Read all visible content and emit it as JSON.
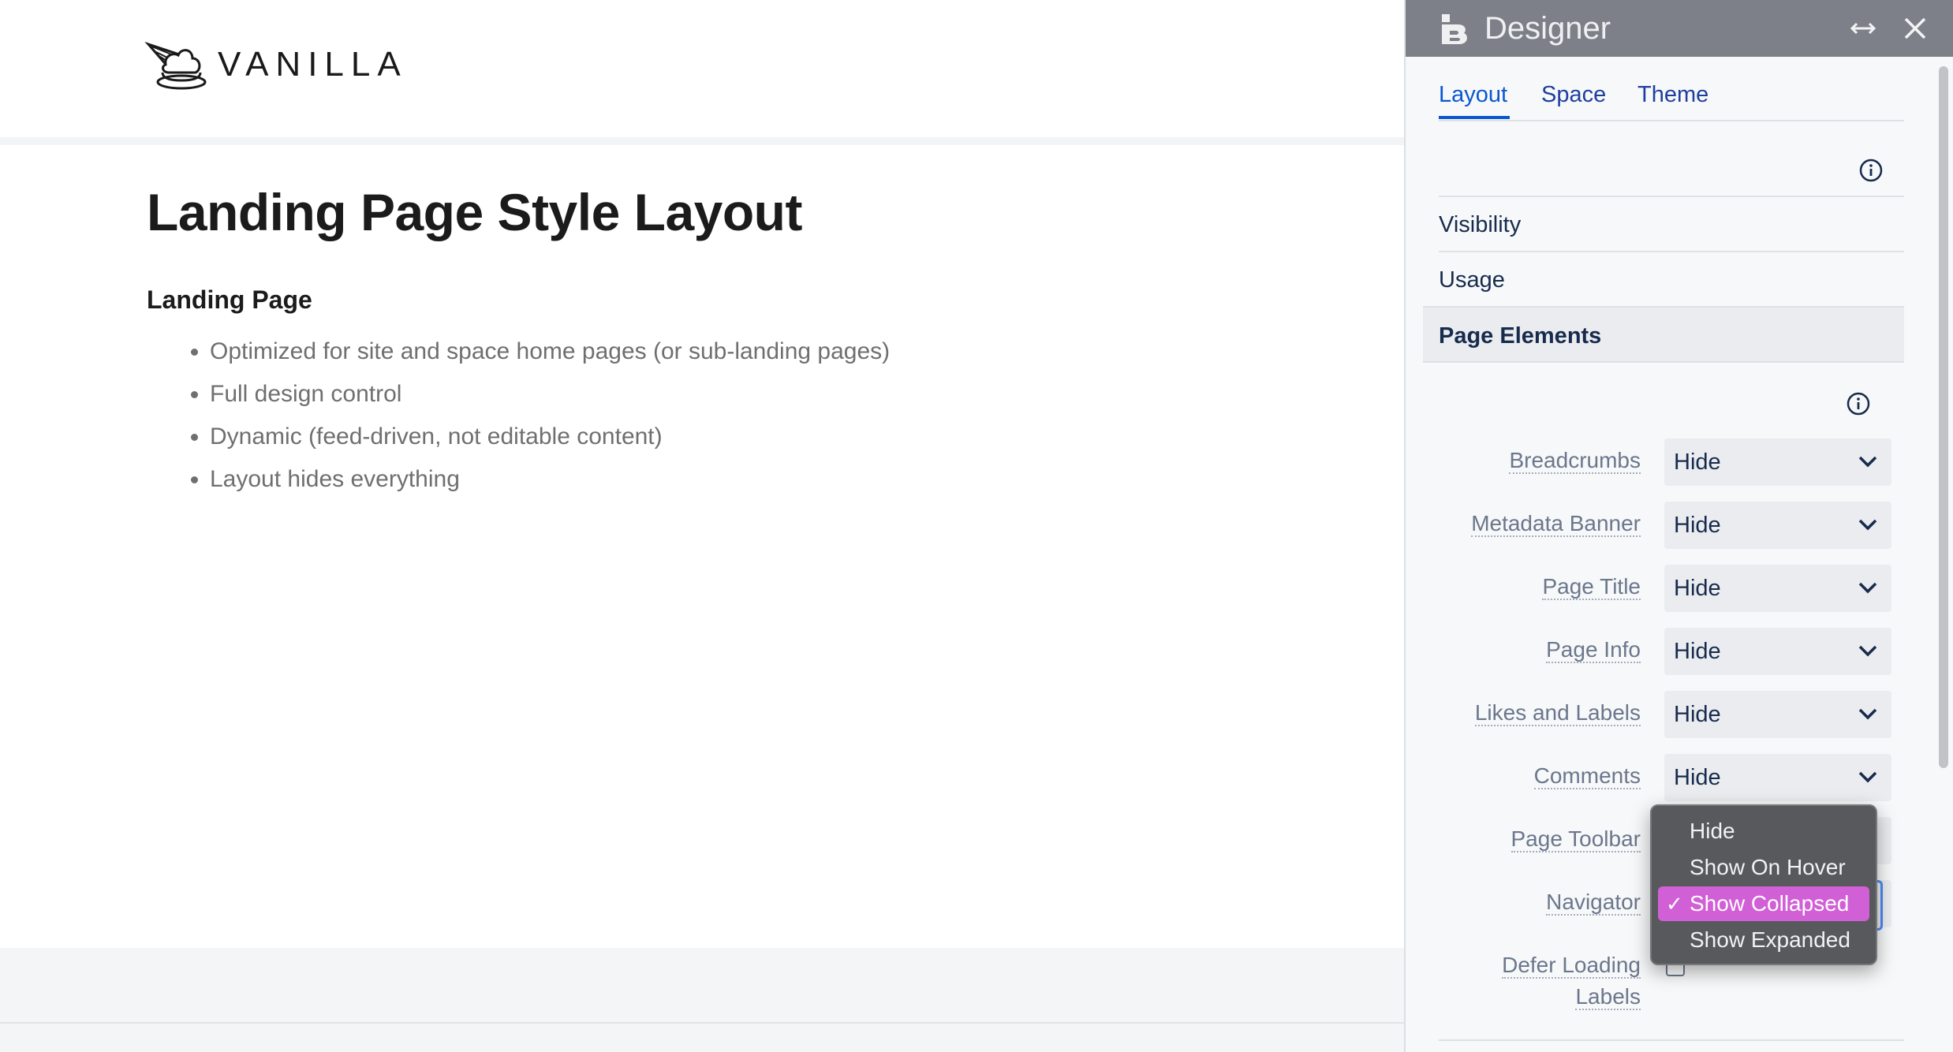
{
  "site": {
    "logo_text": "VANILLA"
  },
  "page": {
    "title": "Landing Page Style Layout",
    "section_heading": "Landing Page",
    "bullets": [
      "Optimized for site and space home pages (or sub-landing pages)",
      "Full design control",
      "Dynamic (feed-driven, not editable content)",
      "Layout hides everything"
    ]
  },
  "designer": {
    "title": "Designer",
    "tabs": [
      "Layout",
      "Space",
      "Theme"
    ],
    "active_tab": "Layout",
    "sections": {
      "visibility": "Visibility",
      "usage": "Usage",
      "page_elements": "Page Elements"
    },
    "settings": [
      {
        "label": "Breadcrumbs",
        "value": "Hide"
      },
      {
        "label": "Metadata Banner",
        "value": "Hide"
      },
      {
        "label": "Page Title",
        "value": "Hide"
      },
      {
        "label": "Page Info",
        "value": "Hide"
      },
      {
        "label": "Likes and Labels",
        "value": "Hide"
      },
      {
        "label": "Comments",
        "value": "Hide"
      },
      {
        "label": "Page Toolbar",
        "value": ""
      },
      {
        "label": "Navigator",
        "value": ""
      }
    ],
    "defer_loading_label_line1": "Defer Loading",
    "defer_loading_label_line2": "Labels",
    "dropdown": {
      "options": [
        "Hide",
        "Show On Hover",
        "Show Collapsed",
        "Show Expanded"
      ],
      "selected": "Show Collapsed",
      "check_mark": "✓"
    }
  },
  "colors": {
    "accent": "#0b57d0",
    "titlebar": "#7d8088",
    "dropdown_bg": "#58595d",
    "selected_option": "#d15fd6"
  }
}
